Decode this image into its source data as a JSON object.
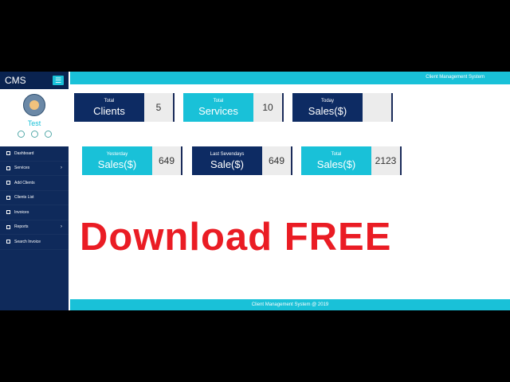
{
  "sidebar": {
    "brand": "CMS",
    "user_name": "Test",
    "items": [
      {
        "label": "Dashboard",
        "chevron": false
      },
      {
        "label": "Services",
        "chevron": true
      },
      {
        "label": "Add Clients",
        "chevron": false
      },
      {
        "label": "Clients List",
        "chevron": false
      },
      {
        "label": "Invoices",
        "chevron": false
      },
      {
        "label": "Reports",
        "chevron": true
      },
      {
        "label": "Search Invoice",
        "chevron": false
      }
    ]
  },
  "topbar": {
    "title": "Client Management System"
  },
  "cards": [
    {
      "small": "Total",
      "big": "Clients",
      "value": "5",
      "style": "dark"
    },
    {
      "small": "Total",
      "big": "Services",
      "value": "10",
      "style": "cyan"
    },
    {
      "small": "Today",
      "big": "Sales($)",
      "value": "",
      "style": "dark"
    },
    {
      "small": "Yesterday",
      "big": "Sales($)",
      "value": "649",
      "style": "cyan"
    },
    {
      "small": "Last Sevendays",
      "big": "Sale($)",
      "value": "649",
      "style": "dark"
    },
    {
      "small": "Total",
      "big": "Sales($)",
      "value": "2123",
      "style": "cyan"
    }
  ],
  "promo": "Download FREE",
  "footer": "Client Management System @ 2019",
  "colors": {
    "accent": "#19c1d8",
    "navy": "#0d2b63",
    "promo": "#ea1c24"
  }
}
